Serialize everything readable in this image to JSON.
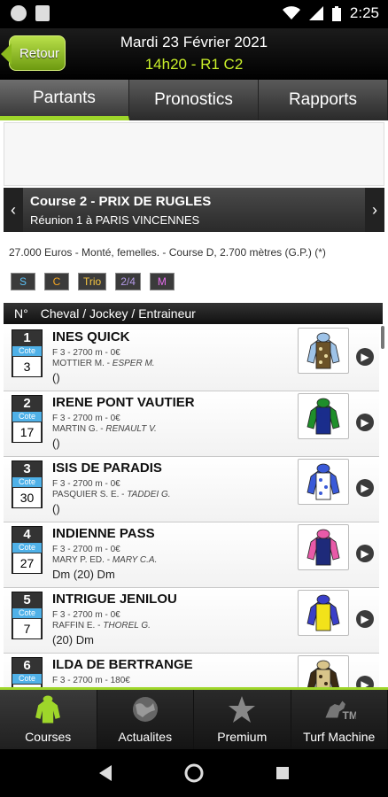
{
  "status": {
    "time": "2:25"
  },
  "header": {
    "back_label": "Retour",
    "date": "Mardi 23 Février 2021",
    "race": "14h20 - R1 C2"
  },
  "tabs": [
    {
      "label": "Partants"
    },
    {
      "label": "Pronostics"
    },
    {
      "label": "Rapports"
    }
  ],
  "course": {
    "title": "Course 2 - PRIX DE RUGLES",
    "subtitle": "Réunion 1 à PARIS VINCENNES",
    "prev_arrow": "‹",
    "next_arrow": "›",
    "info": "27.000 Euros - Monté, femelles. - Course D, 2.700 mètres (G.P.) (*)"
  },
  "bets": [
    {
      "label": "S",
      "color": "#5bc0f5"
    },
    {
      "label": "C",
      "color": "#f5a623"
    },
    {
      "label": "Trio",
      "color": "#f5c542"
    },
    {
      "label": "2/4",
      "color": "#b49ae8"
    },
    {
      "label": "M",
      "color": "#e86ef0"
    }
  ],
  "list_header": {
    "num": "N°",
    "cols": "Cheval / Jockey / Entraineur"
  },
  "runners": [
    {
      "num": "1",
      "cote_label": "Cote",
      "cote": "3",
      "name": "INES QUICK",
      "info": "F 3 - 2700 m - 0€",
      "jockey": "MOTTIER M.",
      "trainer": "ESPER M.",
      "music": "()",
      "silk": {
        "body": "#6b5228",
        "pattern": "#e8d9a0",
        "sleeves": "#9ec3e8",
        "cap": "#9ec3e8"
      }
    },
    {
      "num": "2",
      "cote_label": "Cote",
      "cote": "17",
      "name": "IRENE PONT VAUTIER",
      "info": "F 3 - 2700 m - 0€",
      "jockey": "MARTIN G.",
      "trainer": "RENAULT V.",
      "music": "()",
      "silk": {
        "body": "#1a2d8c",
        "pattern": "#1a2d8c",
        "sleeves": "#1f8f2a",
        "cap": "#1f8f2a"
      }
    },
    {
      "num": "3",
      "cote_label": "Cote",
      "cote": "30",
      "name": "ISIS DE PARADIS",
      "info": "F 3 - 2700 m - 0€",
      "jockey": "PASQUIER S. E.",
      "trainer": "TADDEI G.",
      "music": "()",
      "silk": {
        "body": "#ffffff",
        "pattern": "#3a5ad8",
        "sleeves": "#3a5ad8",
        "cap": "#3a5ad8"
      }
    },
    {
      "num": "4",
      "cote_label": "Cote",
      "cote": "27",
      "name": "INDIENNE PASS",
      "info": "F 3 - 2700 m - 0€",
      "jockey": "MARY P. ED.",
      "trainer": "MARY C.A.",
      "music": "Dm (20) Dm",
      "silk": {
        "body": "#1e2a7a",
        "pattern": "#1e2a7a",
        "sleeves": "#e85aa8",
        "cap": "#e85aa8"
      }
    },
    {
      "num": "5",
      "cote_label": "Cote",
      "cote": "7",
      "name": "INTRIGUE JENILOU",
      "info": "F 3 - 2700 m - 0€",
      "jockey": "RAFFIN E.",
      "trainer": "THOREL G.",
      "music": "(20) Dm",
      "silk": {
        "body": "#f2e21a",
        "pattern": "#f2e21a",
        "sleeves": "#3a3fc8",
        "cap": "#3a3fc8"
      }
    },
    {
      "num": "6",
      "cote_label": "Cote",
      "cote": "",
      "name": "ILDA DE BERTRANGE",
      "info": "F 3 - 2700 m - 180€",
      "jockey": "",
      "trainer": "",
      "music": "",
      "silk": {
        "body": "#d8c48a",
        "pattern": "#3b2a14",
        "sleeves": "#3b2a14",
        "cap": "#d8c48a"
      }
    }
  ],
  "bottom_nav": [
    {
      "label": "Courses",
      "icon": "jockey-silk-icon"
    },
    {
      "label": "Actualites",
      "icon": "globe-icon"
    },
    {
      "label": "Premium",
      "icon": "star-icon"
    },
    {
      "label": "Turf Machine",
      "icon": "turf-machine-icon"
    }
  ]
}
